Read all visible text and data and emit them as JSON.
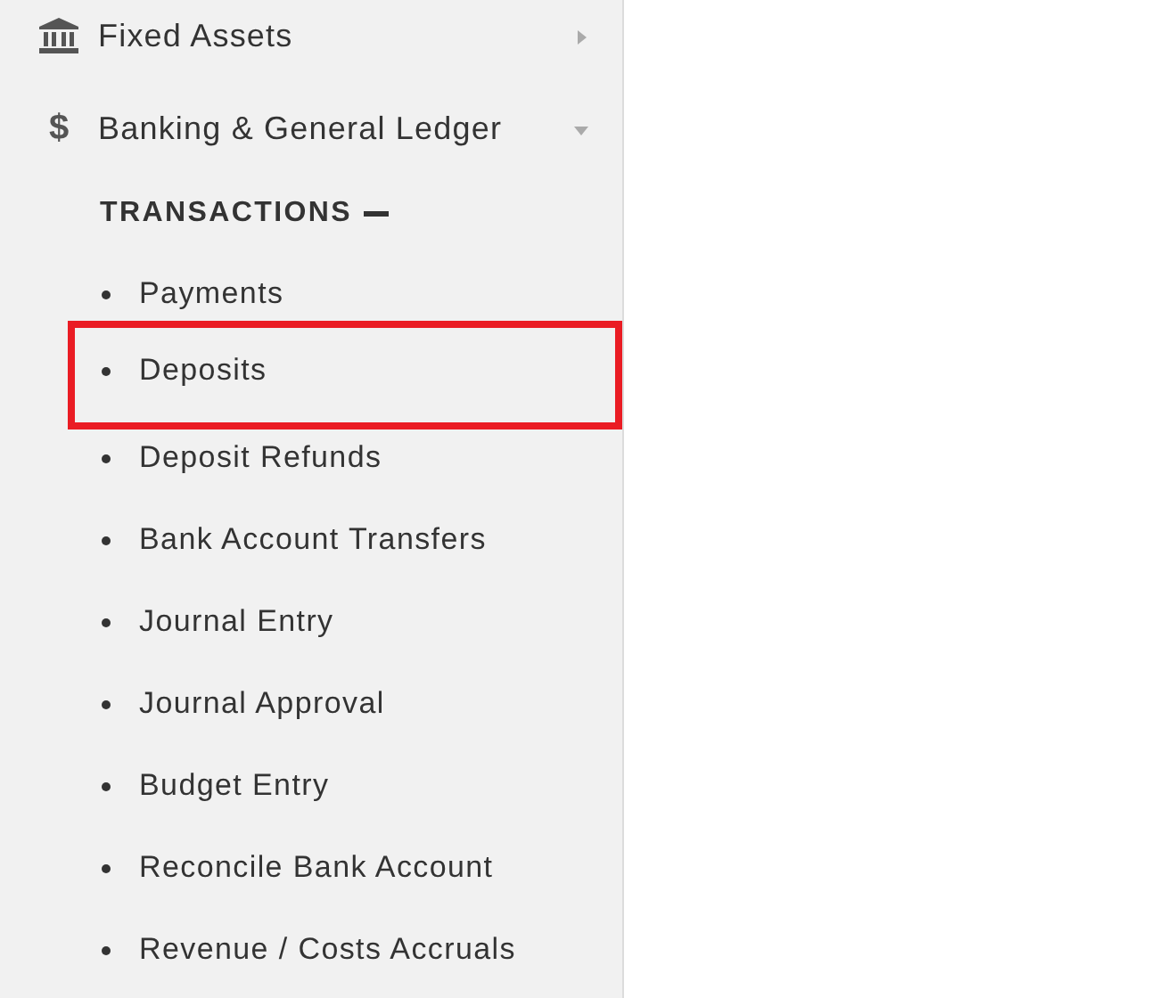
{
  "menu": [
    {
      "kind": "bank",
      "label": "Fixed Assets",
      "expanded": false
    },
    {
      "kind": "symbol",
      "symbol": "$",
      "label": "Banking & General Ledger",
      "expanded": true
    }
  ],
  "section": {
    "title": "TRANSACTIONS",
    "expanded": true
  },
  "items": [
    {
      "label": "Payments",
      "highlighted": false
    },
    {
      "label": "Deposits",
      "highlighted": true
    },
    {
      "label": "Deposit Refunds",
      "highlighted": false
    },
    {
      "label": "Bank Account Transfers",
      "highlighted": false
    },
    {
      "label": "Journal Entry",
      "highlighted": false
    },
    {
      "label": "Journal Approval",
      "highlighted": false
    },
    {
      "label": "Budget Entry",
      "highlighted": false
    },
    {
      "label": "Reconcile Bank Account",
      "highlighted": false
    },
    {
      "label": "Revenue / Costs Accruals",
      "highlighted": false
    }
  ]
}
